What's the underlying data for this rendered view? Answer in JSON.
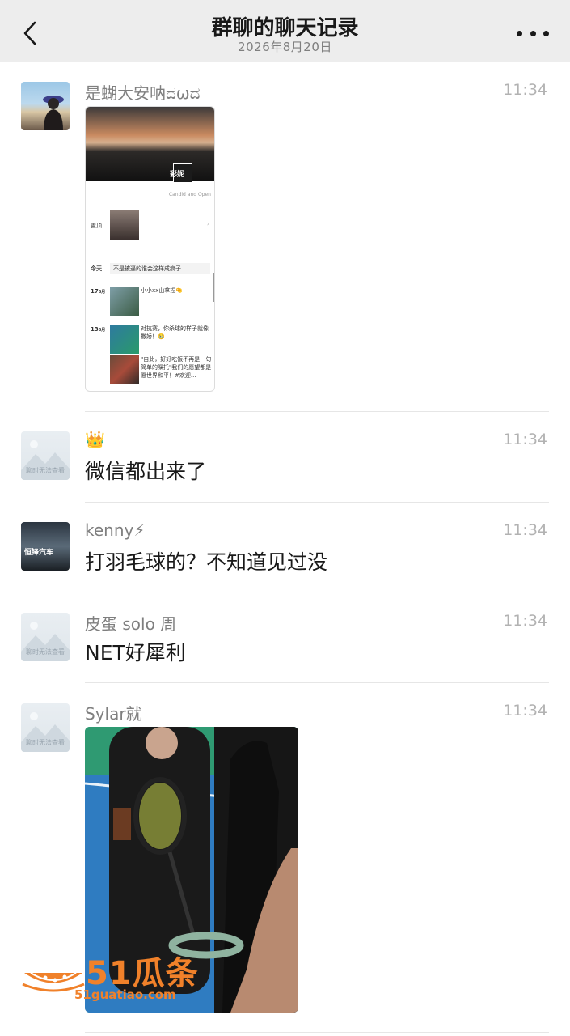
{
  "header": {
    "title": "群聊的聊天记录",
    "subtitle": "2026年8月20日"
  },
  "placeholder_caption": "聊时无法查看",
  "messages": [
    {
      "name": "是蝴大安呐ದωದ",
      "time": "11:34",
      "type": "image",
      "thumbnail": {
        "brand": "彩妮",
        "tagline": "Candid and Open",
        "rows": [
          {
            "label": "置顶",
            "text": ""
          },
          {
            "label": "今天",
            "text": "不是被逼的谁会这样成疯子"
          },
          {
            "label": "17",
            "label_small": "8月",
            "text": "小小xx山拿捏🤏"
          },
          {
            "label": "13",
            "label_small": "8月",
            "text": "对抗赛，你杀球的样子就像撒娇！🥹"
          },
          {
            "label": "",
            "text": "\"自此，好好吃饭不再是一句简单的嘱托\"我们的愿望都是愿世界和平！#欢迎..."
          }
        ]
      }
    },
    {
      "name": "👑",
      "time": "11:34",
      "type": "text",
      "text": "微信都出来了"
    },
    {
      "name": "kenny⚡",
      "time": "11:34",
      "type": "text",
      "text": "打羽毛球的？不知道见过没",
      "avatar_text": "恒锋汽车"
    },
    {
      "name": "皮蛋 solo 周",
      "time": "11:34",
      "type": "text",
      "text": "NET好犀利"
    },
    {
      "name": "Sylar就",
      "time": "11:34",
      "type": "image"
    }
  ],
  "watermark": {
    "brand": "51瓜条",
    "url": "51guatiao.com"
  },
  "colors": {
    "nav_bg": "#ededed",
    "name": "#7f7f7f",
    "time": "#b2b2b2",
    "watermark": "#f0812a"
  }
}
